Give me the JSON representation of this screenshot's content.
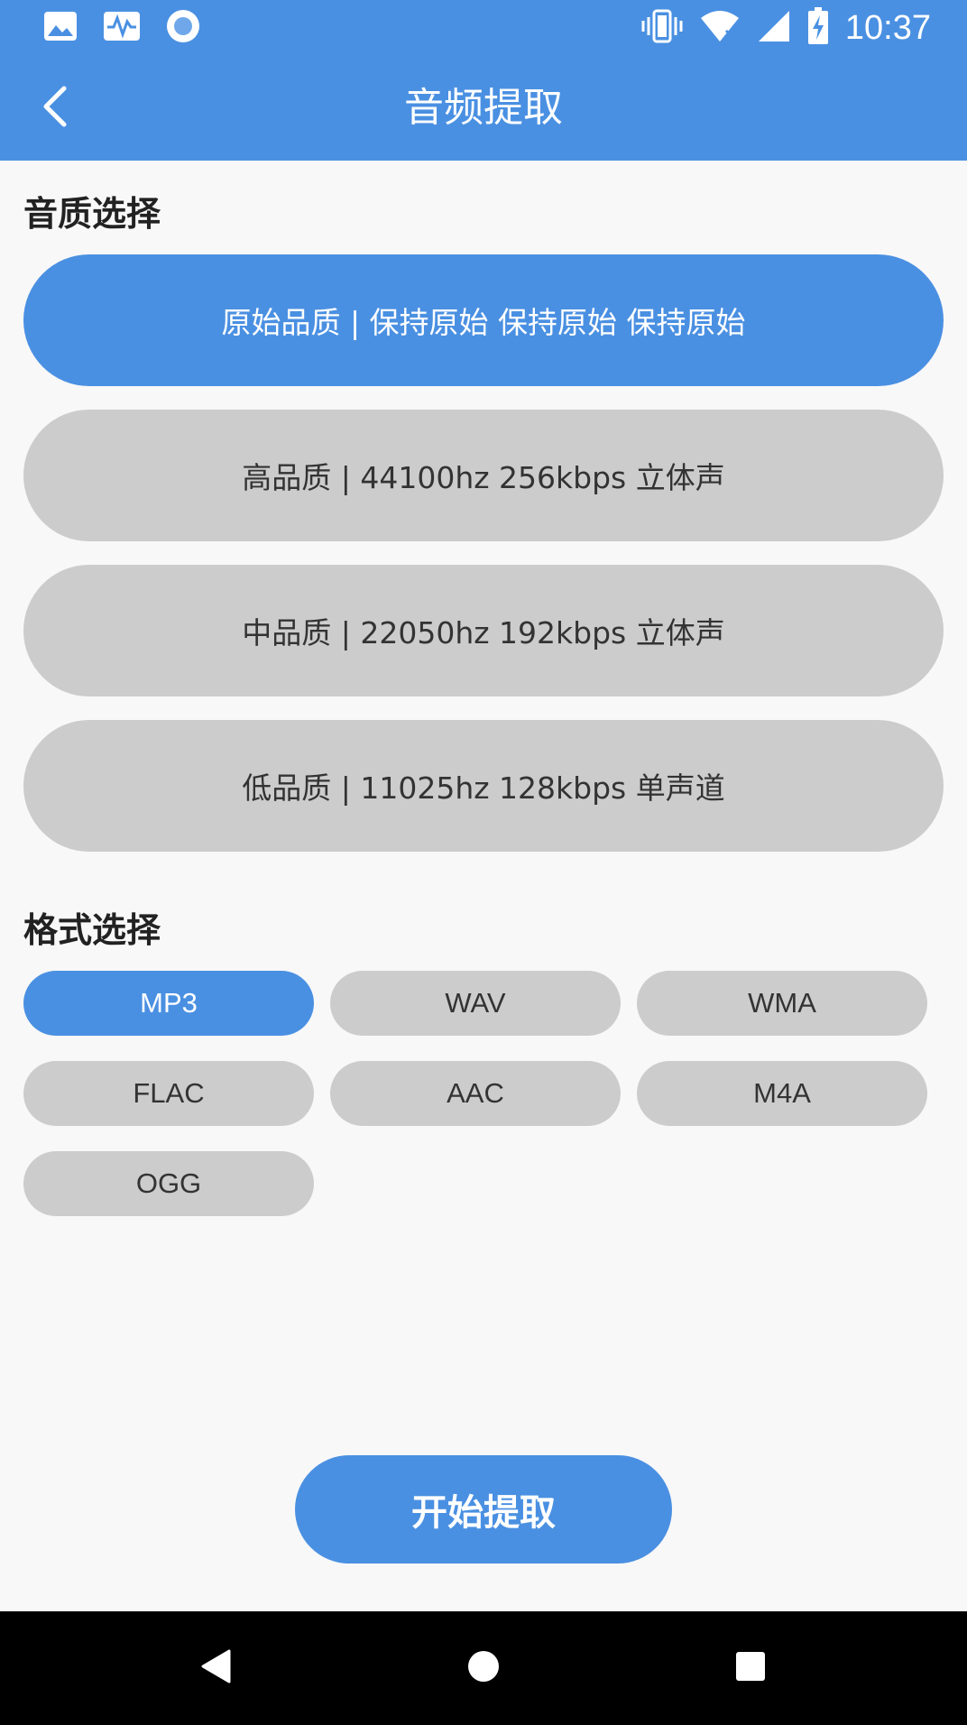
{
  "status_bar": {
    "time": "10:37",
    "left_icons": [
      "image-icon",
      "activity-icon",
      "record-icon"
    ],
    "right_icons": [
      "vibrate-icon",
      "wifi-icon",
      "signal-icon",
      "battery-charging-icon"
    ]
  },
  "app_bar": {
    "title": "音频提取",
    "back_icon": "chevron-left-icon"
  },
  "quality": {
    "section_title": "音质选择",
    "options": [
      {
        "label": "原始品质 | 保持原始 保持原始 保持原始",
        "selected": true
      },
      {
        "label": "高品质 | 44100hz 256kbps 立体声",
        "selected": false
      },
      {
        "label": "中品质 | 22050hz 192kbps 立体声",
        "selected": false
      },
      {
        "label": "低品质 | 11025hz 128kbps 单声道",
        "selected": false
      }
    ]
  },
  "format": {
    "section_title": "格式选择",
    "options": [
      {
        "label": "MP3",
        "selected": true
      },
      {
        "label": "WAV",
        "selected": false
      },
      {
        "label": "WMA",
        "selected": false
      },
      {
        "label": "FLAC",
        "selected": false
      },
      {
        "label": "AAC",
        "selected": false
      },
      {
        "label": "M4A",
        "selected": false
      },
      {
        "label": "OGG",
        "selected": false
      }
    ]
  },
  "start_button": {
    "label": "开始提取"
  },
  "nav_bar": {
    "icons": [
      "back-triangle-icon",
      "home-circle-icon",
      "recents-square-icon"
    ]
  },
  "colors": {
    "accent": "#4a90e2",
    "unselected": "#cccccc",
    "background": "#f8f8f8",
    "nav_bar": "#000000"
  }
}
